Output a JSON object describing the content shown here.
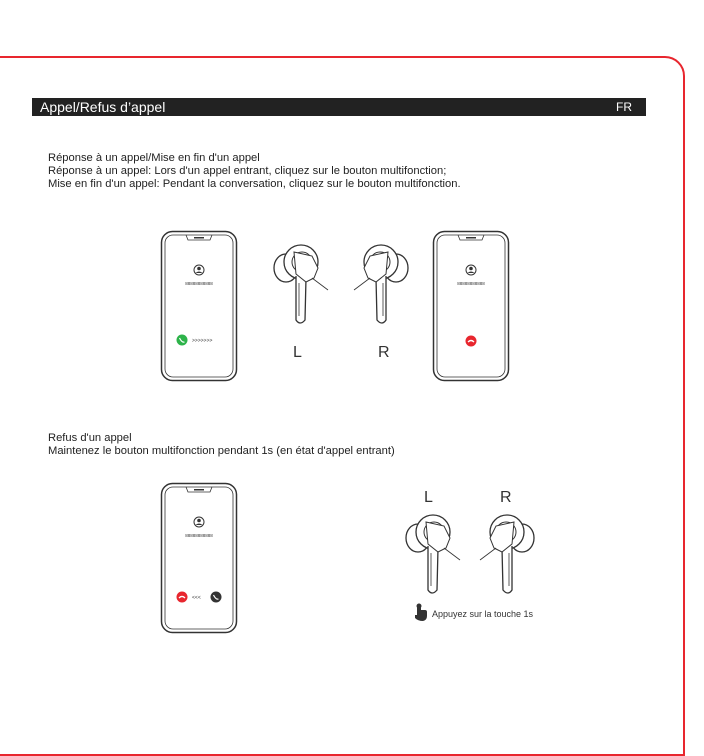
{
  "header": {
    "title": "Appel/Refus d’appel",
    "lang": "FR"
  },
  "section1": {
    "lines": [
      "Réponse à un appel/Mise en fin d'un appel",
      "Réponse à un appel: Lors d'un appel entrant, cliquez sur le bouton multifonction;",
      "Mise en fin d'un appel: Pendant la conversation, cliquez sur le bouton multifonction."
    ],
    "left_label": "L",
    "right_label": "R",
    "phone_number": "88888888888",
    "swipe_arrows": ">>>>>>>"
  },
  "section2": {
    "lines": [
      "Refus d'un appel",
      "Maintenez le bouton multifonction pendant 1s (en état d'appel entrant)"
    ],
    "left_label": "L",
    "right_label": "R",
    "phone_number": "88888888888",
    "reject_arrows": "<<<",
    "hint": "Appuyez sur la touche 1s"
  },
  "colors": {
    "accent_red": "#e8262e",
    "answer_green": "#2db34a",
    "header_bg": "#222222"
  }
}
